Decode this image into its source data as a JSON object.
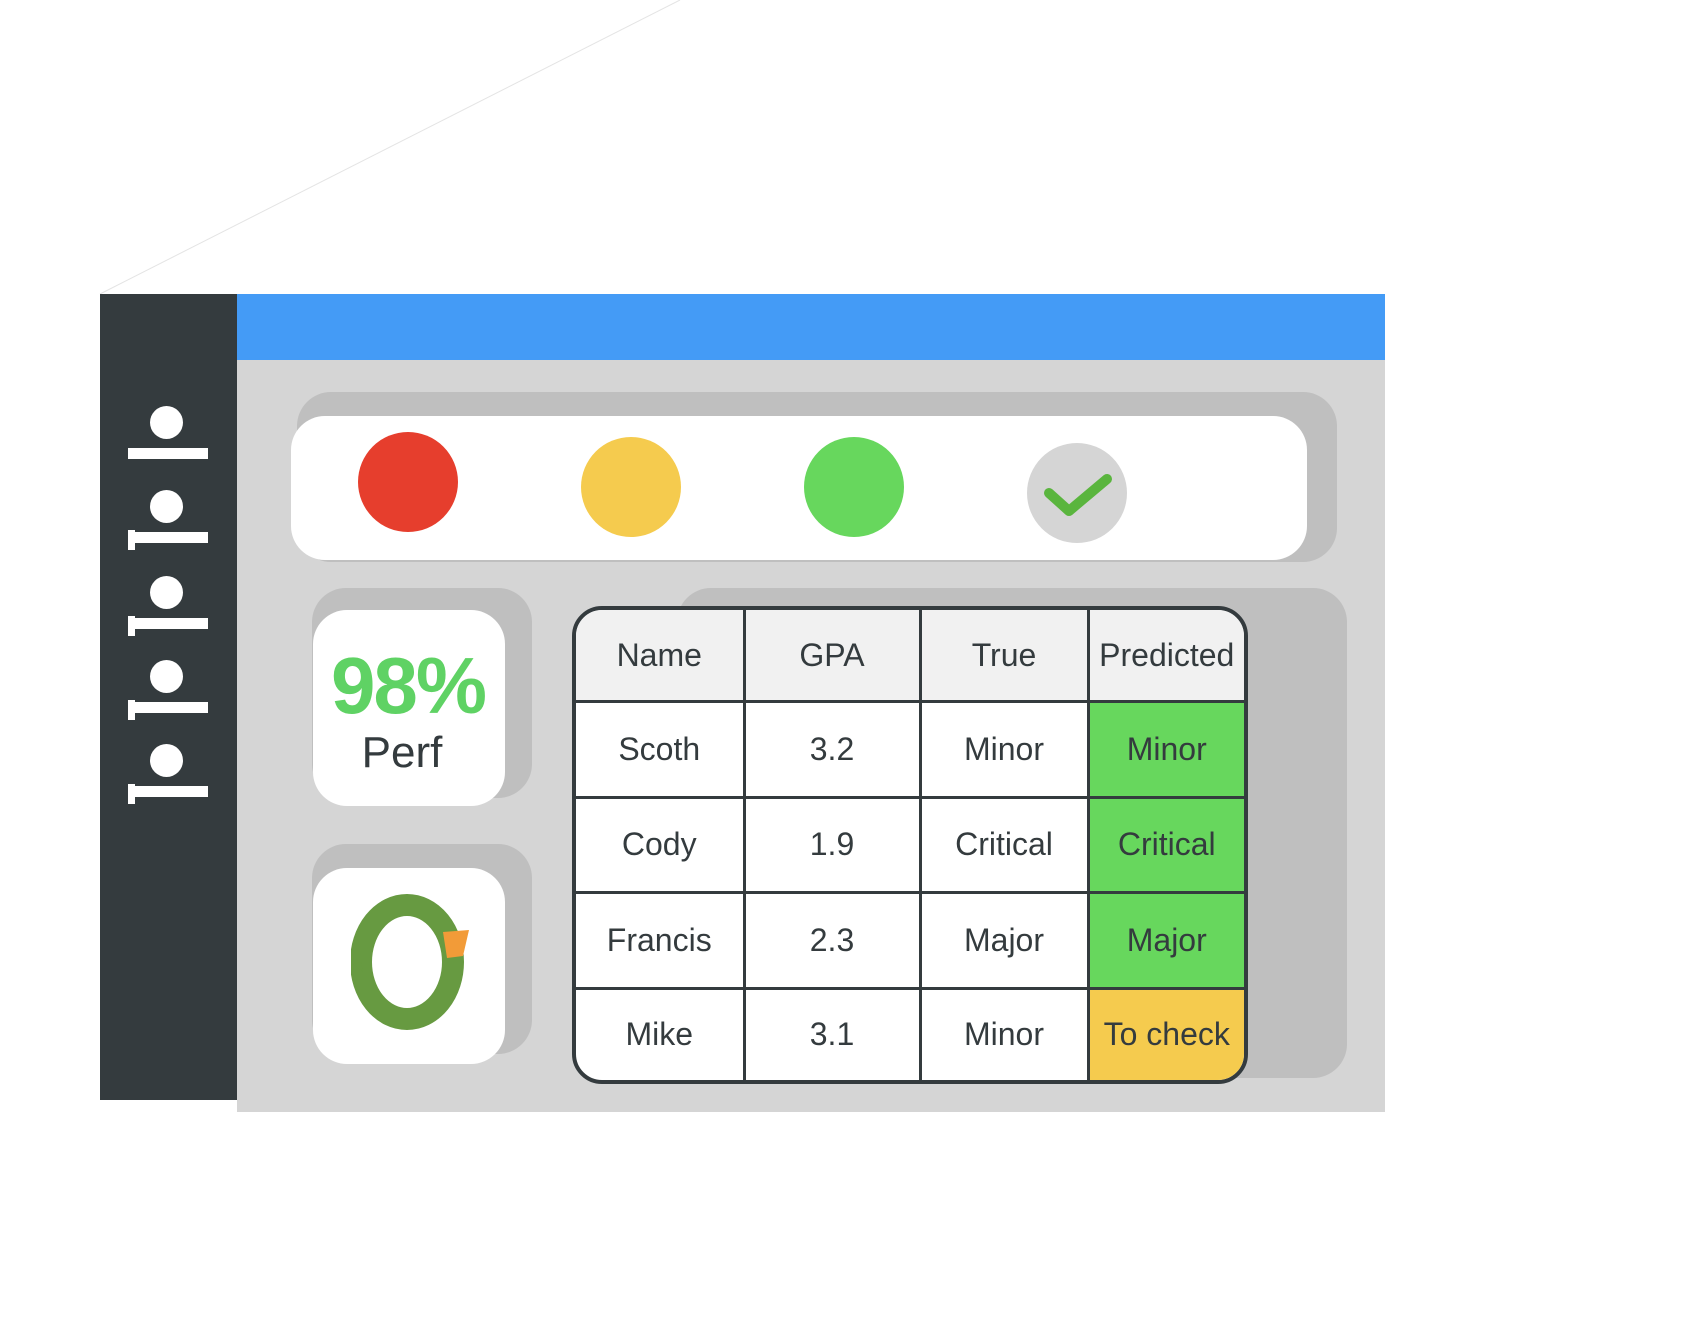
{
  "status_lights": [
    {
      "name": "red",
      "color": "#e63e2d"
    },
    {
      "name": "yellow",
      "color": "#f5cb4e"
    },
    {
      "name": "green",
      "color": "#67d75d"
    },
    {
      "name": "check",
      "icon": "checkmark-icon",
      "color": "#5ab53e"
    }
  ],
  "perf_card": {
    "value": "98%",
    "label": "Perf"
  },
  "table": {
    "headers": [
      "Name",
      "GPA",
      "True",
      "Predicted"
    ],
    "rows": [
      {
        "name": "Scoth",
        "gpa": "3.2",
        "true": "Minor",
        "predicted": "Minor",
        "status_color": "#67d75d"
      },
      {
        "name": "Cody",
        "gpa": "1.9",
        "true": "Critical",
        "predicted": "Critical",
        "status_color": "#67d75d"
      },
      {
        "name": "Francis",
        "gpa": "2.3",
        "true": "Major",
        "predicted": "Major",
        "status_color": "#67d75d"
      },
      {
        "name": "Mike",
        "gpa": "3.1",
        "true": "Minor",
        "predicted": "To check",
        "status_color": "#f5cb4e"
      }
    ]
  },
  "colors": {
    "titlebar": "#449bf6",
    "sidebar": "#343b3e",
    "accent_green": "#5fd264",
    "accent_orange": "#f29b38",
    "donut_green": "#679a41"
  }
}
